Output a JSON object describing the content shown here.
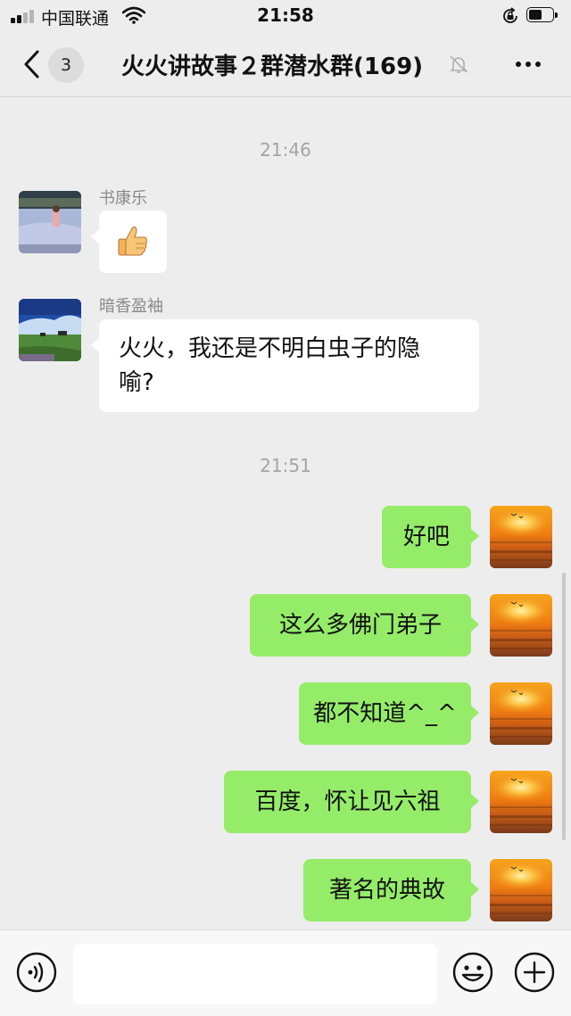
{
  "status_bar": {
    "carrier": "中国联通",
    "time": "21:58",
    "icons": [
      "signal-icon",
      "wifi-icon",
      "orientation-lock-icon",
      "battery-icon"
    ]
  },
  "nav": {
    "unread_count": "3",
    "title": "火火讲故事２群潜水群(169)",
    "icons": [
      "back-chevron-icon",
      "mute-bell-icon",
      "more-icon"
    ]
  },
  "messages": {
    "time1": "21:46",
    "m1": {
      "sender": "书康乐",
      "content": "thumbs-up-emoji",
      "avatar": "waterside-photo-avatar"
    },
    "m2": {
      "sender": "暗香盈袖",
      "text_line1": "火火，我还是不明白虫子的隐",
      "text_line2": "喻?",
      "avatar": "grassland-photo-avatar"
    },
    "time2": "21:51",
    "outgoing": [
      {
        "text": "好吧"
      },
      {
        "text": "这么多佛门弟子"
      },
      {
        "text": "都不知道^_^"
      },
      {
        "text": "百度，怀让见六祖"
      },
      {
        "text": "著名的典故"
      }
    ],
    "self_avatar": "sunset-photo-avatar"
  },
  "input_bar": {
    "text": "",
    "icons": [
      "voice-input-icon",
      "emoji-icon",
      "plus-icon"
    ]
  },
  "colors": {
    "background": "#ededed",
    "outgoing_bubble": "#95ec69",
    "incoming_bubble": "#ffffff",
    "timestamp_text": "#a4a4a4"
  }
}
